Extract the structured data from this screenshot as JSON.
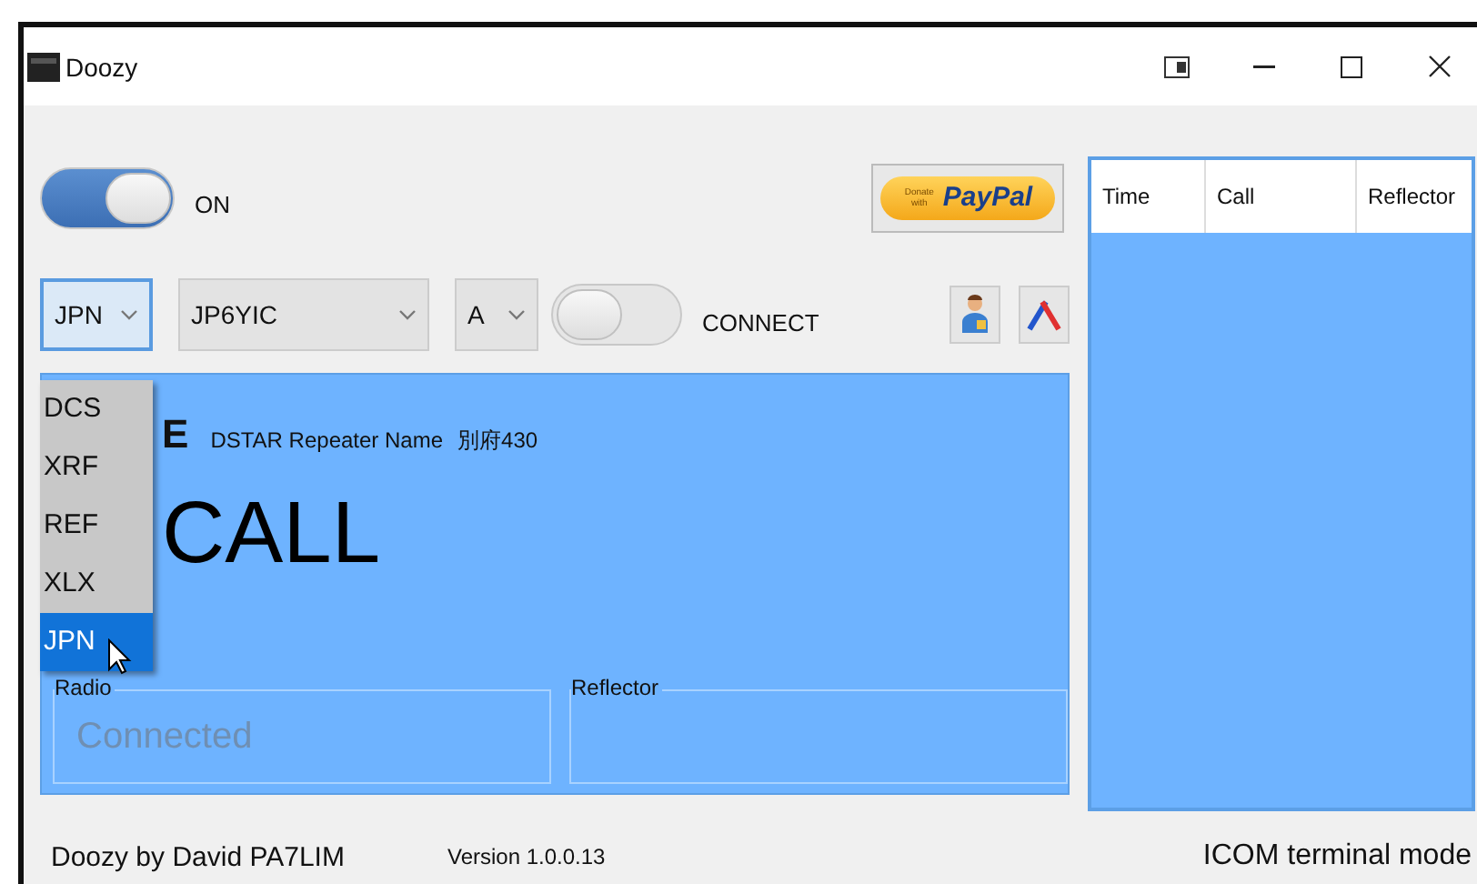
{
  "window": {
    "title": "Doozy"
  },
  "power": {
    "on": true,
    "label": "ON"
  },
  "donate_button": {
    "small": "Donate with",
    "label": "PayPal"
  },
  "mode_select": {
    "value": "JPN",
    "open": true,
    "options": [
      {
        "label": "DCS",
        "selected": false
      },
      {
        "label": "XRF",
        "selected": false
      },
      {
        "label": "REF",
        "selected": false
      },
      {
        "label": "XLX",
        "selected": false
      },
      {
        "label": "JPN",
        "selected": true
      }
    ]
  },
  "repeater_select": {
    "value": "JP6YIC"
  },
  "module_select": {
    "value": "A"
  },
  "connect": {
    "on": false,
    "label": "CONNECT"
  },
  "status_panel": {
    "label_fragment": "E",
    "repeater_caption": "DSTAR Repeater Name",
    "repeater_name": "別府430",
    "callsign": "CALL",
    "radio": {
      "legend": "Radio",
      "value": "Connected"
    },
    "reflector": {
      "legend": "Reflector"
    }
  },
  "log_table": {
    "columns": [
      "Time",
      "Call",
      "Reflector"
    ]
  },
  "status_bar": {
    "credit": "Doozy by David PA7LIM",
    "version": "Version 1.0.0.13",
    "mode": "ICOM terminal mode"
  }
}
